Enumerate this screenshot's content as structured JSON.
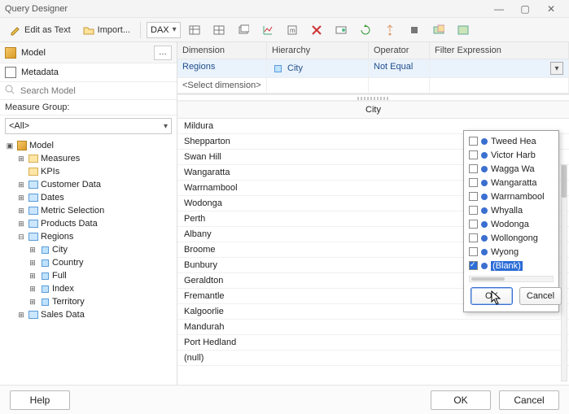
{
  "window": {
    "title": "Query Designer"
  },
  "toolbar": {
    "edit_as_text": "Edit as Text",
    "import": "Import...",
    "mode": "DAX"
  },
  "left": {
    "model_label": "Model",
    "metadata_label": "Metadata",
    "search_placeholder": "Search Model",
    "measure_group_label": "Measure Group:",
    "measure_group_value": "<All>",
    "tree": {
      "root": "Model",
      "measures": "Measures",
      "kpis": "KPIs",
      "customer_data": "Customer Data",
      "dates": "Dates",
      "metric_selection": "Metric Selection",
      "products_data": "Products Data",
      "regions": "Regions",
      "city": "City",
      "country": "Country",
      "full": "Full",
      "index": "Index",
      "territory": "Territory",
      "sales_data": "Sales Data"
    }
  },
  "filter": {
    "headers": {
      "dimension": "Dimension",
      "hierarchy": "Hierarchy",
      "operator": "Operator",
      "expression": "Filter Expression"
    },
    "row": {
      "dimension": "Regions",
      "hierarchy": "City",
      "operator": "Not Equal"
    },
    "select_dimension": "<Select dimension>"
  },
  "results": {
    "header": "City",
    "rows": [
      "Mildura",
      "Shepparton",
      "Swan Hill",
      "Wangaratta",
      "Warrnambool",
      "Wodonga",
      "Perth",
      "Albany",
      "Broome",
      "Bunbury",
      "Geraldton",
      "Fremantle",
      "Kalgoorlie",
      "Mandurah",
      "Port Hedland",
      "(null)"
    ]
  },
  "popup": {
    "items": [
      {
        "label": "Tweed Hea",
        "checked": false
      },
      {
        "label": "Victor Harb",
        "checked": false
      },
      {
        "label": "Wagga Wa",
        "checked": false
      },
      {
        "label": "Wangaratta",
        "checked": false
      },
      {
        "label": "Warrnambool",
        "checked": false
      },
      {
        "label": "Whyalla",
        "checked": false
      },
      {
        "label": "Wodonga",
        "checked": false
      },
      {
        "label": "Wollongong",
        "checked": false
      },
      {
        "label": "Wyong",
        "checked": false
      },
      {
        "label": "(Blank)",
        "checked": true,
        "selected": true
      }
    ],
    "ok": "OK",
    "cancel": "Cancel"
  },
  "footer": {
    "help": "Help",
    "ok": "OK",
    "cancel": "Cancel"
  }
}
